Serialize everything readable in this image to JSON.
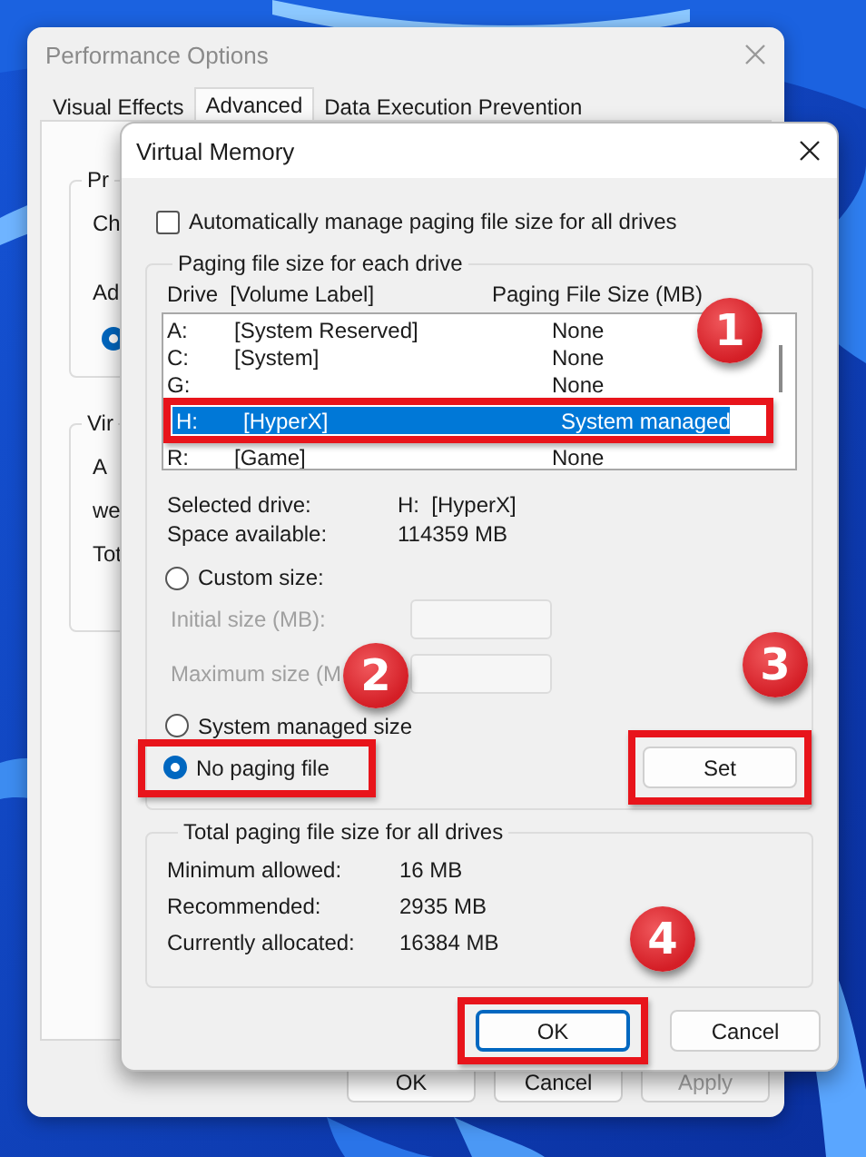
{
  "background_window": {
    "title": "Performance Options",
    "tabs": [
      {
        "label": "Visual Effects",
        "selected": false
      },
      {
        "label": "Advanced",
        "selected": true
      },
      {
        "label": "Data Execution Prevention",
        "selected": false
      }
    ],
    "groups": [
      {
        "items": [
          {
            "kind": "legend",
            "text": "Pr"
          },
          {
            "kind": "text",
            "text": "Ch"
          },
          {
            "kind": "text",
            "text": "Ad"
          },
          {
            "kind": "radio",
            "selected": true
          }
        ]
      },
      {
        "items": [
          {
            "kind": "legend",
            "text": "Vir"
          },
          {
            "kind": "text",
            "text": "A"
          },
          {
            "kind": "text",
            "text": "we"
          },
          {
            "kind": "text",
            "text": "Tot"
          }
        ]
      }
    ],
    "buttons": [
      {
        "label": "OK",
        "disabled": false
      },
      {
        "label": "Cancel",
        "disabled": false
      },
      {
        "label": "Apply",
        "disabled": true
      }
    ]
  },
  "dialog": {
    "title": "Virtual Memory",
    "auto_manage": {
      "label": "Automatically manage paging file size for all drives",
      "checked": false
    },
    "drives_group": {
      "title": "Paging file size for each drive",
      "columns": [
        "Drive  [Volume Label]",
        "Paging File Size (MB)"
      ],
      "drives": [
        {
          "drive": "A:",
          "label": "[System Reserved]",
          "size": "None",
          "selected": false,
          "highlighted": false
        },
        {
          "drive": "C:",
          "label": "[System]",
          "size": "None",
          "selected": false,
          "highlighted": false
        },
        {
          "drive": "G:",
          "size": "None",
          "selected": false,
          "highlighted": false
        },
        {
          "drive": "H:",
          "label": "[HyperX]",
          "size": "System managed",
          "selected": true,
          "highlighted": true
        },
        {
          "drive": "R:",
          "label": "[Game]",
          "size": "None",
          "selected": false,
          "highlighted": false
        }
      ],
      "info": [
        {
          "label": "Selected drive:",
          "value": "H:  [HyperX]"
        },
        {
          "label": "Space available:",
          "value": "114359 MB"
        }
      ],
      "options": [
        {
          "kind": "radio",
          "label": "Custom size:",
          "selected": false,
          "highlighted": false
        },
        {
          "kind": "field",
          "label": "Initial size (MB):",
          "disabled": true
        },
        {
          "kind": "field",
          "label": "Maximum size (M",
          "disabled": true
        },
        {
          "kind": "radio",
          "label": "System managed size",
          "selected": false,
          "highlighted": false
        },
        {
          "kind": "radio",
          "label": "No paging file",
          "selected": true,
          "highlighted": true
        }
      ],
      "set_button": {
        "label": "Set",
        "highlighted": true
      }
    },
    "totals_group": {
      "title": "Total paging file size for all drives",
      "rows": [
        {
          "label": "Minimum allowed:",
          "value": "16 MB"
        },
        {
          "label": "Recommended:",
          "value": "2935 MB"
        },
        {
          "label": "Currently allocated:",
          "value": "16384 MB"
        }
      ]
    },
    "buttons": [
      {
        "label": "OK",
        "focused": true,
        "highlighted": true
      },
      {
        "label": "Cancel",
        "focused": false,
        "highlighted": false
      }
    ]
  },
  "annotations": [
    {
      "label": "1"
    },
    {
      "label": "2"
    },
    {
      "label": "3"
    },
    {
      "label": "4"
    }
  ]
}
